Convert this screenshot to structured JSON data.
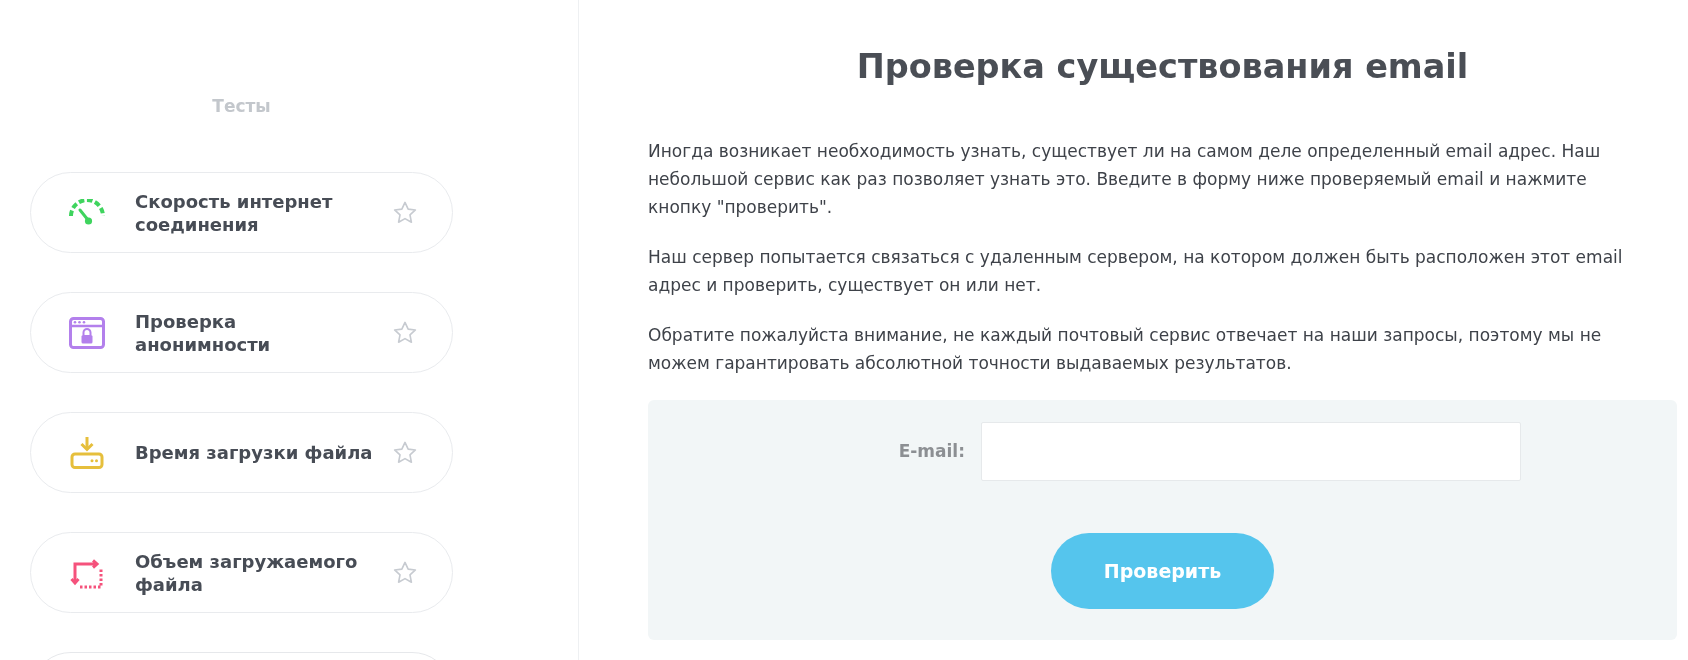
{
  "sidebar": {
    "title": "Тесты",
    "items": [
      {
        "label": "Скорость интернет соединения",
        "color": "#3fd45e",
        "favorite": false
      },
      {
        "label": "Проверка анонимности",
        "color": "#b380ec",
        "favorite": false
      },
      {
        "label": "Время загрузки файла",
        "color": "#e6bf3c",
        "favorite": false
      },
      {
        "label": "Объем загружаемого файла",
        "color": "#f5527c",
        "favorite": false
      }
    ],
    "more_below": true
  },
  "main": {
    "title": "Проверка существования email",
    "paragraphs": [
      "Иногда возникает необходимость узнать, существует ли на самом деле определенный email адрес. Наш небольшой сервис как раз позволяет узнать это. Введите в форму ниже проверяемый email и нажмите кнопку \"проверить\".",
      "Наш сервер попытается связаться с удаленным сервером, на котором должен быть расположен этот email адрес и проверить, существует он или нет.",
      "Обратите пожалуйста внимание, не каждый почтовый сервис отвечает на наши запросы, поэтому мы не можем гарантировать абсолютной точности выдаваемых результатов."
    ],
    "form": {
      "label": "E-mail:",
      "button": "Проверить"
    }
  }
}
